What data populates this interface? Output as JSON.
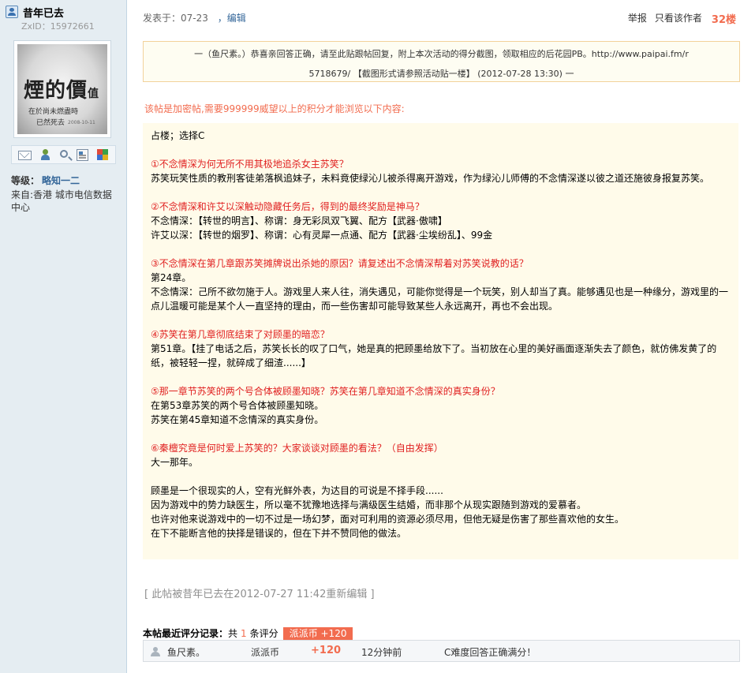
{
  "author": {
    "name": "昔年已去",
    "zxid": "ZxID：15972661",
    "avatar": {
      "big_text": "煙的價",
      "big_text_small": "值",
      "line1": "在於尚未燃盡時",
      "line2": "已然死去",
      "date": "2008-10-11"
    },
    "level_label": "等级：",
    "level_value": "略知一二",
    "from": "来自:香港 城市电信数据中心"
  },
  "post_header": {
    "posted": "发表于：07-23",
    "edit": "，编辑",
    "report": "举报",
    "only_author": "只看该作者",
    "floor": "32楼"
  },
  "notice": {
    "line1": "一（鱼尺素。）恭喜亲回答正确，请至此贴跟帖回复，附上本次活动的得分截图，领取相应的后花园PB。http://www.paipai.fm/r",
    "line2": "5718679/ 【截图形式请参照活动贴一楼】 (2012-07-28 13:30) 一"
  },
  "encrypted_note": "该帖是加密帖,需要999999威望以上的积分才能浏览以下内容:",
  "content": {
    "l01": "占楼；选择C",
    "q1": "①不念情深为何无所不用其极地追杀女主苏笑？",
    "a1": "苏笑玩笑性质的教刑客徒弟落枫追妹子，未料竟使绿沁儿被杀得离开游戏，作为绿沁儿师傅的不念情深遂以彼之道还施彼身报复苏笑。",
    "q2": "②不念情深和许艾以深触动隐藏任务后，得到的最终奖励是神马？",
    "a2a": "不念情深：【转世的明言】、称谓：身无彩凤双飞翼、配方【武器·傲啸】",
    "a2b": "许艾以深：【转世的烟罗】、称谓：心有灵犀一点通、配方【武器·尘埃纷乱】、99金",
    "q3": "③不念情深在第几章跟苏笑摊牌说出杀她的原因？请复述出不念情深帮着对苏笑说教的话？",
    "a3a": "第24章。",
    "a3b": "不念情深：己所不欲勿施于人。游戏里人来人往，消失遇见，可能你觉得是一个玩笑，别人却当了真。能够遇见也是一种缘分，游戏里的一点儿温暖可能是某个人一直坚持的理由，而一些伤害却可能导致某些人永远离开，再也不会出现。",
    "q4": "④苏笑在第几章彻底结束了对顾墨的暗恋？",
    "a4": "第51章。【挂了电话之后，苏笑长长的叹了口气，她是真的把顾墨给放下了。当初放在心里的美好画面逐渐失去了颜色，就仿佛发黄了的纸，被轻轻一捏，就碎成了细渣......】",
    "q5": "⑤那一章节苏笑的两个号合体被顾墨知晓？苏笑在第几章知道不念情深的真实身份？",
    "a5a": "在第53章苏笑的两个号合体被顾墨知晓。",
    "a5b": "苏笑在第45章知道不念情深的真实身份。",
    "q6": "⑥秦檀究竟是何时爱上苏笑的？大家谈谈对顾墨的看法？（自由发挥）",
    "a6a": "大一那年。",
    "a6b": "顾墨是一个很现实的人，空有光鲜外表，为达目的可说是不择手段......",
    "a6c": "因为游戏中的势力缺医生，所以毫不犹豫地选择与满级医生结婚，而非那个从现实跟随到游戏的爱慕者。",
    "a6d": "也许对他来说游戏中的一切不过是一场幻梦，面对可利用的资源必须尽用，但他无疑是伤害了那些喜欢他的女生。",
    "a6e": "在下不能断言他的抉择是错误的，但在下并不赞同他的做法。"
  },
  "edited_note": "[ 此帖被昔年已去在2012-07-27 11:42重新编辑 ]",
  "rating": {
    "title": "本帖最近评分记录：",
    "count_prefix": "共",
    "count": "1",
    "count_suffix": "条评分",
    "tag": "派派币 +120",
    "row": {
      "user": "鱼尺素。",
      "type": "派派币",
      "score": "+120",
      "time": "12分钟前",
      "reason": "C难度回答正确满分！"
    }
  },
  "colors": {
    "sidebar_bg": "#e5edf2",
    "accent_orange": "#f26c4f",
    "link_blue": "#336699",
    "question_red": "#e02020",
    "content_bg": "#fffbea"
  }
}
